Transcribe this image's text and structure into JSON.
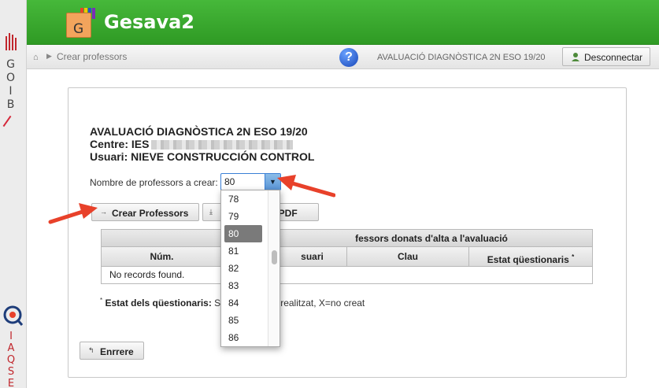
{
  "brand": {
    "goib_letters": [
      "G",
      "O",
      "I",
      "B"
    ],
    "iaqse_letters": [
      "I",
      "A",
      "Q",
      "S",
      "E"
    ],
    "colors": {
      "header_green": "#3aa82e",
      "accent_red": "#e8412a",
      "goib_red": "#c1272d"
    }
  },
  "header": {
    "logo_letter": "G",
    "app_title": "Gesava2"
  },
  "breadcrumb": {
    "home_icon": "home-icon",
    "current": "Crear professors"
  },
  "topbar": {
    "help_icon": "?",
    "context": "AVALUACIÓ DIAGNÒSTICA 2N ESO 19/20",
    "logout_label": "Desconnectar"
  },
  "info": {
    "title": "AVALUACIÓ DIAGNÒSTICA 2N ESO 19/20",
    "centre_label": "Centre: IES",
    "usuari": "Usuari: NIEVE CONSTRUCCIÓN CONTROL"
  },
  "form": {
    "count_label": "Nombre de professors a crear:",
    "count_value": "80"
  },
  "buttons": {
    "crear": "Crear Professors",
    "pdf": "u PDF",
    "enrrere": "Enrrere"
  },
  "table": {
    "caption": "fessors donats d'alta a l'avaluació",
    "headers": [
      "Núm.",
      "suari",
      "Clau",
      "Estat qüestionaris"
    ],
    "empty": "No records found."
  },
  "note": {
    "label": "Estat dels qüestionaris:",
    "text": " S",
    "tail": "no realitzat, X=no creat"
  },
  "dropdown": {
    "options": [
      "78",
      "79",
      "80",
      "81",
      "82",
      "83",
      "84",
      "85",
      "86"
    ],
    "selected": "80"
  }
}
